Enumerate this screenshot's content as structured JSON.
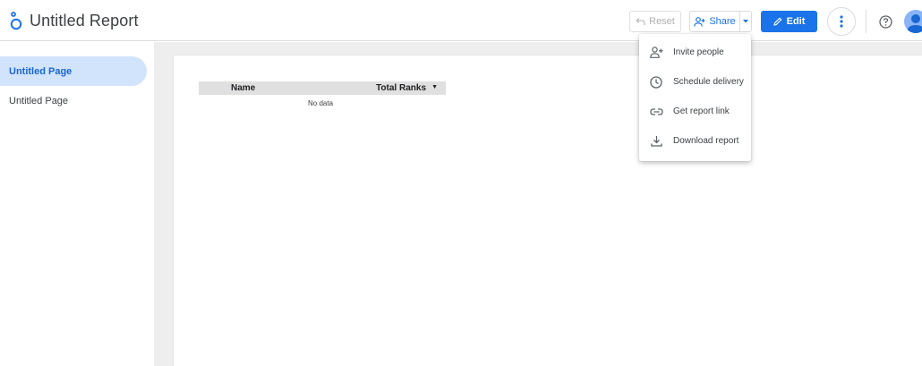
{
  "header": {
    "title": "Untitled Report",
    "logo_icon": "looker-studio-logo",
    "reset_label": "Reset",
    "share_label": "Share",
    "edit_label": "Edit"
  },
  "sidebar": {
    "pages": [
      {
        "label": "Untitled Page",
        "active": true
      },
      {
        "label": "Untitled Page",
        "active": false
      }
    ]
  },
  "table": {
    "columns": [
      "Name",
      "Total Ranks"
    ],
    "sort_column": "Total Ranks",
    "empty_text": "No data"
  },
  "share_menu": {
    "items": [
      {
        "label": "Invite people",
        "icon": "person-add-icon"
      },
      {
        "label": "Schedule delivery",
        "icon": "clock-icon"
      },
      {
        "label": "Get report link",
        "icon": "link-icon"
      },
      {
        "label": "Download report",
        "icon": "download-icon"
      }
    ]
  },
  "colors": {
    "accent": "#1a73e8",
    "active_page_bg": "#d2e3fc",
    "canvas_bg": "#eeeeee",
    "table_header_bg": "#e0e0e0"
  }
}
